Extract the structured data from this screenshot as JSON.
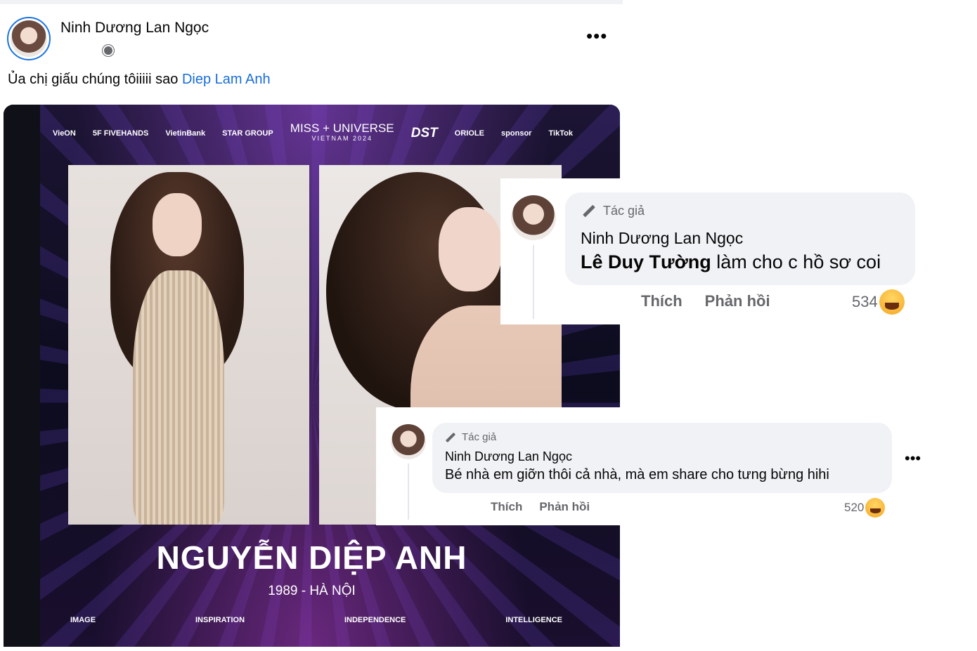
{
  "post": {
    "author": "Ninh Dương Lan Ngọc",
    "text": "Ủa chị giấu chúng tôiiiii sao",
    "mention": "Diep Lam Anh",
    "more_label": "•••",
    "audience_icon": "globe-icon"
  },
  "poster": {
    "sponsors": [
      "VieON",
      "5F FIVEHANDS",
      "VietinBank",
      "STAR GROUP",
      "DST",
      "ORIOLE",
      "sponsor",
      "TikTok"
    ],
    "event_title": "MISS + UNIVERSE",
    "event_subtitle": "VIETNAM 2024",
    "contestant_name": "NGUYỄN DIỆP ANH",
    "contestant_info": "1989 - HÀ NỘI",
    "values": [
      "IMAGE",
      "INSPIRATION",
      "INDEPENDENCE",
      "INTELLIGENCE"
    ]
  },
  "comments": [
    {
      "badge": "Tác giả",
      "author": "Ninh Dương Lan Ngọc",
      "mention": "Lê Duy Tường",
      "text": "làm cho c hồ sơ coi",
      "like_label": "Thích",
      "reply_label": "Phản hồi",
      "reaction_count": "534",
      "reaction_icon": "haha-emoji-icon"
    },
    {
      "badge": "Tác giả",
      "author": "Ninh Dương Lan Ngọc",
      "text": "Bé nhà em giỡn thôi cả nhà, mà em share cho tưng bừng hihi",
      "like_label": "Thích",
      "reply_label": "Phản hồi",
      "reaction_count": "520",
      "reaction_icon": "haha-emoji-icon",
      "more_label": "•••"
    }
  ]
}
